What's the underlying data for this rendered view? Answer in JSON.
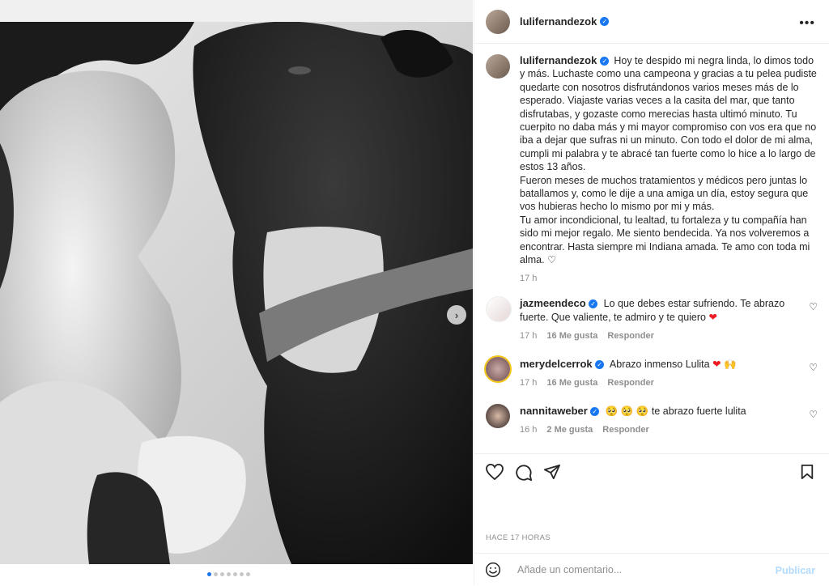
{
  "post": {
    "author": "lulifernandezok",
    "caption": "Hoy te despido mi negra linda, lo dimos todo y más. Luchaste como una campeona y gracias a tu pelea pudiste quedarte con nosotros disfrutándonos varios meses más de lo esperado. Viajaste varias veces a la casita del mar, que tanto disfrutabas, y gozaste como merecias hasta ultimó minuto. Tu cuerpito no daba más y mi mayor compromiso con vos era que no iba a dejar que sufras ni un minuto. Con todo el dolor de mi alma, cumpli mi palabra y te abracé tan fuerte como lo hice a lo largo de estos 13 años.",
    "caption_p2": "Fueron meses de muchos tratamientos y médicos pero juntas lo batallamos y, como le dije a una amiga un día, estoy segura que vos hubieras hecho lo mismo por mi y más.",
    "caption_p3": "Tu amor incondicional, tu lealtad, tu fortaleza y tu compañía han sido mi mejor regalo. Me siento bendecida. Ya nos volveremos a encontrar. Hasta siempre mi Indiana amada. Te amo con toda mi alma. ♡",
    "time": "17 h"
  },
  "comments": [
    {
      "user": "jazmeendeco",
      "text": "Lo que debes estar sufriendo. Te abrazo fuerte. Que valiente, te admiro y te quiero",
      "emoji": "❤",
      "time": "17 h",
      "likes": "16 Me gusta",
      "reply": "Responder"
    },
    {
      "user": "merydelcerrok",
      "text": "Abrazo inmenso Lulita",
      "emoji": "❤ 🙌",
      "time": "17 h",
      "likes": "16 Me gusta",
      "reply": "Responder"
    },
    {
      "user": "nannitaweber",
      "text": "te abrazo fuerte lulita",
      "emoji_prefix": "🥺 🥺 🥺",
      "time": "16 h",
      "likes": "2 Me gusta",
      "reply": "Responder"
    }
  ],
  "footer": {
    "ago": "HACE 17 HORAS",
    "comment_placeholder": "Añade un comentario...",
    "publish": "Publicar"
  },
  "colors": {
    "verified": "#1877f2",
    "heart": "#ed1c24",
    "publish_disabled": "#b3dbff"
  }
}
